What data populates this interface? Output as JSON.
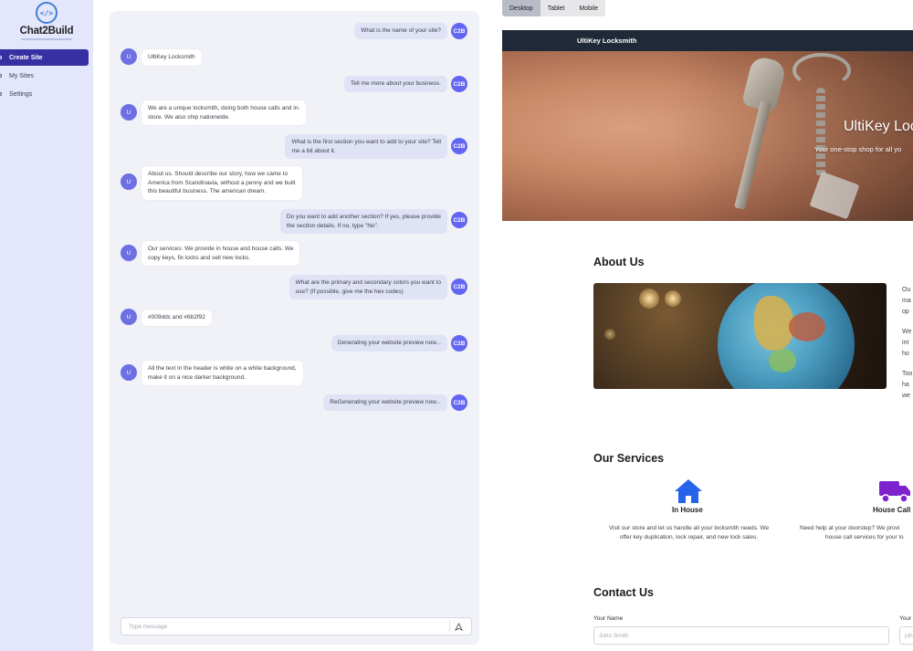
{
  "sidebar": {
    "logo_text": "Chat2Build",
    "logo_glyph": "</>",
    "items": [
      {
        "label": "Create Site",
        "active": true
      },
      {
        "label": "My Sites",
        "active": false
      },
      {
        "label": "Settings",
        "active": false
      }
    ]
  },
  "chat": {
    "bot_avatar": "C2B",
    "user_avatar": "U",
    "messages": [
      {
        "from": "bot",
        "lines": [
          "What is the name of your site?"
        ]
      },
      {
        "from": "user",
        "lines": [
          "UltiKey Locksmith"
        ]
      },
      {
        "from": "bot",
        "lines": [
          "Tell me more about your business."
        ]
      },
      {
        "from": "user",
        "lines": [
          "We are a unique locksmith, doing both house calls and in-",
          "store. We also ship nationwide."
        ]
      },
      {
        "from": "bot",
        "lines": [
          "What is the first section you want to add to your site? Tell",
          "me a bit about it."
        ]
      },
      {
        "from": "user",
        "lines": [
          "About us. Should describe our story, how we came to",
          "America from Scandinavia, without a penny and we built",
          "this beautiful business. The american dream."
        ]
      },
      {
        "from": "bot",
        "lines": [
          "Do you want to add another section? If yes, please provide",
          "the section details. If no, type \"No\"."
        ]
      },
      {
        "from": "user",
        "lines": [
          "Our services: We provide in house and house calls. We",
          "copy keys, fix locks and sell new locks."
        ]
      },
      {
        "from": "bot",
        "lines": [
          "What are the primary and secondary colors you want to",
          "use? (If possible, give me the hex codes)"
        ]
      },
      {
        "from": "user",
        "lines": [
          "#009ddc and #6b2f92"
        ]
      },
      {
        "from": "bot",
        "lines": [
          "Generating your website preview now..."
        ]
      },
      {
        "from": "user",
        "lines": [
          "All the text in the header is white on a white background,",
          "make it on a nice darker background."
        ]
      },
      {
        "from": "bot",
        "lines": [
          "ReGenerating your website preview now..."
        ]
      }
    ],
    "input_placeholder": "Type message",
    "send_icon": "send-icon"
  },
  "preview": {
    "device_tabs": [
      {
        "label": "Desktop",
        "active": true
      },
      {
        "label": "Tablet",
        "active": false
      },
      {
        "label": "Mobile",
        "active": false
      }
    ],
    "site_name": "UltiKey Locksmith",
    "hero_title": "UltiKey Lock",
    "hero_subtitle": "Your one-stop shop for all yo",
    "about_title": "About Us",
    "about_lines": [
      "Ou",
      "ma",
      "op",
      "",
      "We",
      "int",
      "ho",
      "",
      "Too",
      "ha",
      "we"
    ],
    "services_title": "Our Services",
    "services": [
      {
        "name": "In House",
        "icon": "house-icon",
        "desc": [
          "Visit our store and let us handle all your locksmith needs. We",
          "offer key duplication, lock repair, and new lock sales."
        ]
      },
      {
        "name": "House Call",
        "icon": "truck-icon",
        "desc": [
          "Need help at your doorstep? We provi",
          "house call services for your lo"
        ]
      }
    ],
    "contact_title": "Contact Us",
    "contact_fields": [
      {
        "label": "Your Name",
        "placeholder": "John Smith"
      },
      {
        "label": "Your",
        "placeholder": "joh"
      }
    ],
    "colors": {
      "header": "#1f2937",
      "icon": "#2563eb",
      "icon_secondary": "#7e22ce"
    }
  }
}
